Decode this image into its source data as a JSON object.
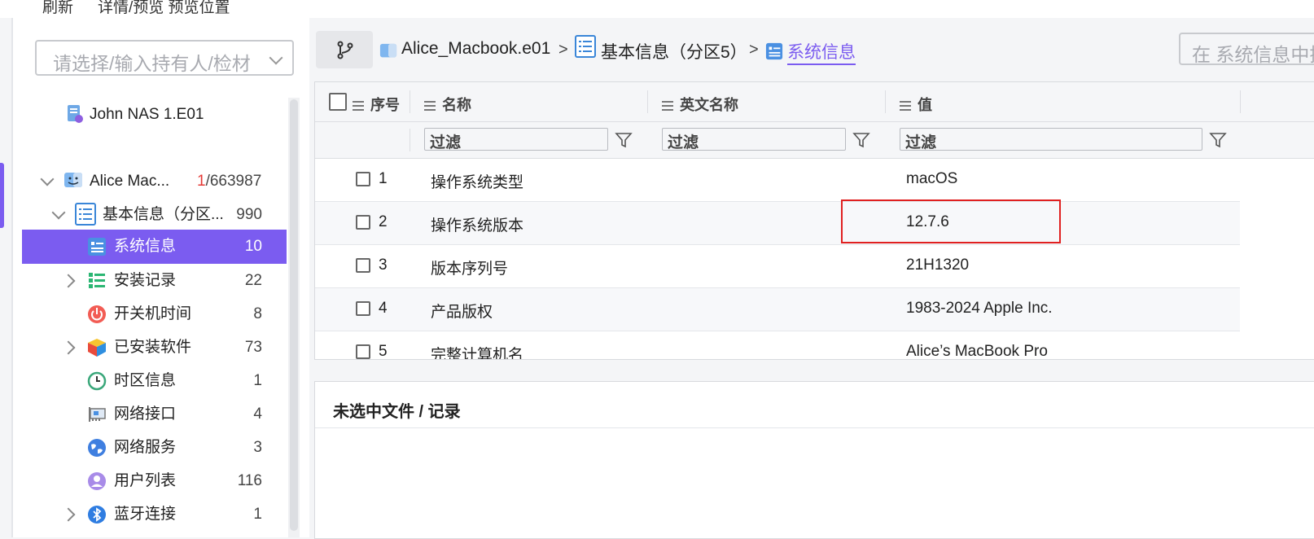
{
  "toolbar": {
    "refresh": "刷新",
    "detail_preview": "详情/预览 预览位置"
  },
  "owner_select": {
    "placeholder": "请选择/输入持有人/检材"
  },
  "tree": {
    "top_item": {
      "label": "John NAS 1.E01"
    },
    "case": {
      "label": "Alice Mac...",
      "count_highlight": "1",
      "count_rest": "/663987"
    },
    "partition": {
      "label": "基本信息（分区...",
      "count": "990"
    },
    "items": [
      {
        "label": "系统信息",
        "count": "10",
        "icon": "system-info-icon",
        "expandable": false,
        "selected": true
      },
      {
        "label": "安装记录",
        "count": "22",
        "icon": "install-records-icon",
        "expandable": true,
        "selected": false
      },
      {
        "label": "开关机时间",
        "count": "8",
        "icon": "power-icon",
        "expandable": false,
        "selected": false
      },
      {
        "label": "已安装软件",
        "count": "73",
        "icon": "software-cube-icon",
        "expandable": true,
        "selected": false
      },
      {
        "label": "时区信息",
        "count": "1",
        "icon": "clock-icon",
        "expandable": false,
        "selected": false
      },
      {
        "label": "网络接口",
        "count": "4",
        "icon": "network-card-icon",
        "expandable": false,
        "selected": false
      },
      {
        "label": "网络服务",
        "count": "3",
        "icon": "globe-icon",
        "expandable": false,
        "selected": false
      },
      {
        "label": "用户列表",
        "count": "116",
        "icon": "user-icon",
        "expandable": false,
        "selected": false
      },
      {
        "label": "蓝牙连接",
        "count": "1",
        "icon": "bluetooth-icon",
        "expandable": true,
        "selected": false
      }
    ]
  },
  "breadcrumb": {
    "items": [
      "Alice_Macbook.e01",
      "基本信息（分区5）",
      "系统信息"
    ],
    "separator": ">"
  },
  "search": {
    "placeholder": "在 系统信息中搜索"
  },
  "grid": {
    "headers": [
      "序号",
      "名称",
      "英文名称",
      "值"
    ],
    "filter_placeholder": "过滤",
    "rows": [
      {
        "index": "1",
        "name": "操作系统类型",
        "en_name": "",
        "value": "macOS"
      },
      {
        "index": "2",
        "name": "操作系统版本",
        "en_name": "",
        "value": "12.7.6"
      },
      {
        "index": "3",
        "name": "版本序列号",
        "en_name": "",
        "value": "21H1320"
      },
      {
        "index": "4",
        "name": "产品版权",
        "en_name": "",
        "value": "1983-2024 Apple Inc."
      },
      {
        "index": "5",
        "name": "完整计算机名",
        "en_name": "",
        "value": "Alice’s MacBook Pro"
      }
    ]
  },
  "details": {
    "title": "未选中文件 / 记录"
  },
  "colors": {
    "accent": "#7b5cf0",
    "highlight_border": "#e02020",
    "count_red": "#e53935"
  }
}
